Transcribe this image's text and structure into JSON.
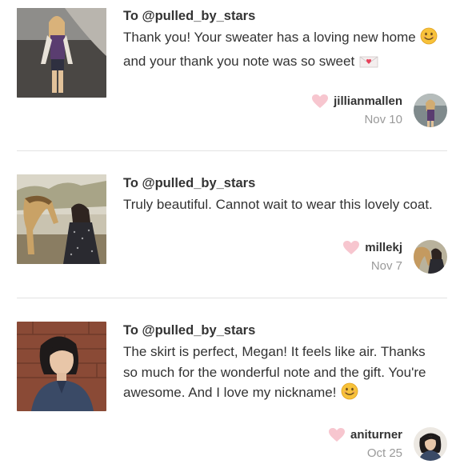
{
  "reviews": [
    {
      "to": "To @pulled_by_stars",
      "message_parts": [
        "Thank you! Your sweater has a loving new home",
        "and your thank you note was so sweet"
      ],
      "username": "jillianmallen",
      "date": "Nov 10"
    },
    {
      "to": "To @pulled_by_stars",
      "message": "Truly beautiful. Cannot wait to wear this lovely coat.",
      "username": "millekj",
      "date": "Nov 7"
    },
    {
      "to": "To @pulled_by_stars",
      "message": "The skirt is perfect, Megan! It feels like air. Thanks so much for the wonderful note and the gift. You're awesome. And I love my nickname!",
      "username": "aniturner",
      "date": "Oct 25"
    }
  ],
  "icons": {
    "like": "heart-icon",
    "smile": "smiling-face-emoji",
    "letter": "love-letter-emoji"
  },
  "colors": {
    "heart": "#f7c6cf",
    "text": "#333333",
    "date": "#9a9a9a",
    "divider": "#e3e3e3"
  }
}
